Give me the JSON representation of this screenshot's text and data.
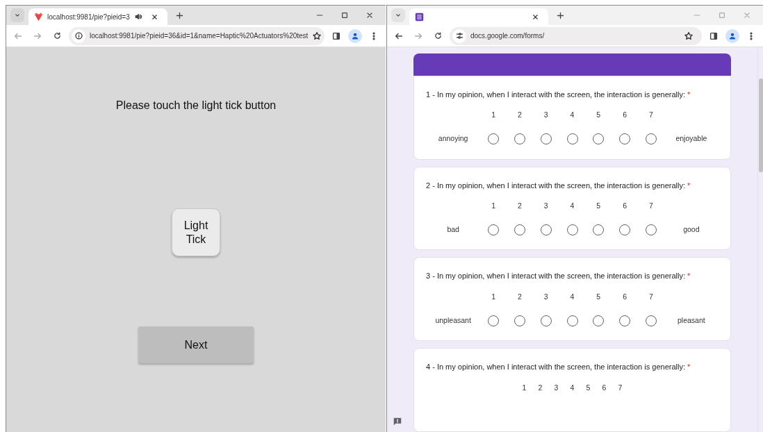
{
  "left_window": {
    "tab": {
      "title": "localhost:9981/pie?pieid=3",
      "audio_playing": true
    },
    "address": "localhost:9981/pie?pieid=36&id=1&name=Haptic%20Actuators%20test",
    "instruction": "Please touch the light tick button",
    "tick_button": "Light Tick",
    "next_button": "Next"
  },
  "right_window": {
    "address": "docs.google.com/forms/",
    "questions": [
      {
        "title": "1 - In my opinion, when I interact with the screen, the interaction is generally:",
        "required_mark": "*",
        "scale": [
          "1",
          "2",
          "3",
          "4",
          "5",
          "6",
          "7"
        ],
        "low_label": "annoying",
        "high_label": "enjoyable",
        "options": [
          {
            "selected": false
          },
          {
            "selected": false
          },
          {
            "selected": false
          },
          {
            "selected": false
          },
          {
            "selected": false
          },
          {
            "selected": false
          },
          {
            "selected": false
          }
        ]
      },
      {
        "title": "2 - In my opinion, when I interact with the screen, the interaction is generally:",
        "required_mark": "*",
        "scale": [
          "1",
          "2",
          "3",
          "4",
          "5",
          "6",
          "7"
        ],
        "low_label": "bad",
        "high_label": "good",
        "options": [
          {
            "selected": false
          },
          {
            "selected": false
          },
          {
            "selected": false
          },
          {
            "selected": false
          },
          {
            "selected": false
          },
          {
            "selected": false
          },
          {
            "selected": false
          }
        ]
      },
      {
        "title": "3 - In my opinion, when I interact with the screen, the interaction is generally:",
        "required_mark": "*",
        "scale": [
          "1",
          "2",
          "3",
          "4",
          "5",
          "6",
          "7"
        ],
        "low_label": "unpleasant",
        "high_label": "pleasant",
        "options": [
          {
            "selected": false
          },
          {
            "selected": false
          },
          {
            "selected": false
          },
          {
            "selected": false
          },
          {
            "selected": false
          },
          {
            "selected": false
          },
          {
            "selected": false
          }
        ]
      },
      {
        "title": "4 - In my opinion, when I interact with the screen, the interaction is generally:",
        "required_mark": "*",
        "scale": [
          "1",
          "2",
          "3",
          "4",
          "5",
          "6",
          "7"
        ]
      }
    ]
  }
}
